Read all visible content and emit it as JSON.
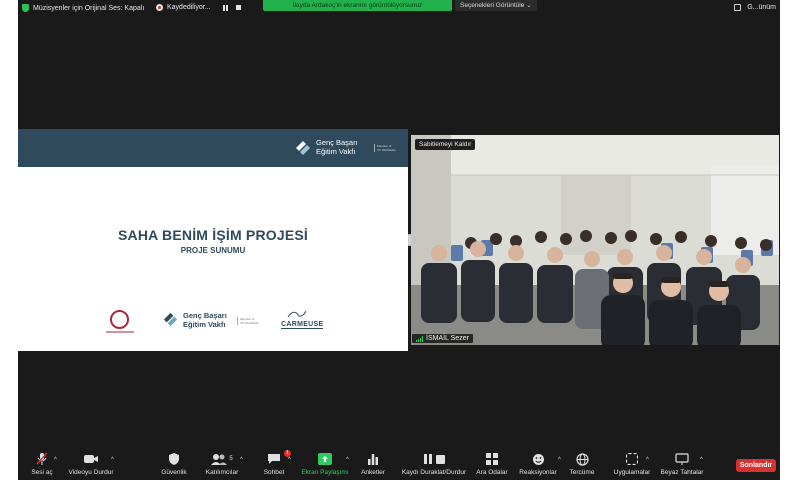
{
  "top_bar": {
    "music_status": "Müzisyenler için Orijinal Ses: Kapalı",
    "recording_status": "Kaydediliyor...",
    "share_banner": "İlayda Ardakoç'in ekranını görüntülüyorsunuz",
    "view_options": "Seçenekleri Görüntüle",
    "view_options_caret": "⌄",
    "gallery_label": "G...ünüm"
  },
  "slide": {
    "logo_line1": "Genç Başarı",
    "logo_line2": "Eğitim Vakfı",
    "member_line1": "Member of",
    "member_line2": "VK Worldwide",
    "title": "SAHA BENİM İŞİM PROJESİ",
    "subtitle": "PROJE SUNUMU",
    "carmeuse": "CARMEUSE",
    "carmeuse_mark": "ws",
    "brand_color": "#2f4a5c"
  },
  "camera": {
    "unpin_label": "Sabitlemeyi Kaldır",
    "participant_name": "İSMAİL Sezer"
  },
  "toolbar": {
    "audio": "Sesi aç",
    "video": "Videoyu Durdur",
    "security": "Güvenlik",
    "participants": "Katılımcılar",
    "participants_count": "5",
    "chat": "Sohbet",
    "chat_badge": "1",
    "share": "Ekran Paylaşımı",
    "polls": "Anketler",
    "pause_record": "Kaydı Duraklat/Durdur",
    "breakout": "Ara Odalar",
    "reactions": "Reaksiyonlar",
    "translate": "Tercüme",
    "apps": "Uygulamalar",
    "whiteboard": "Beyaz Tahtalar",
    "end": "Sonlandır",
    "caret": "^",
    "accent_green": "#2ecc5a",
    "end_red": "#d93030"
  }
}
